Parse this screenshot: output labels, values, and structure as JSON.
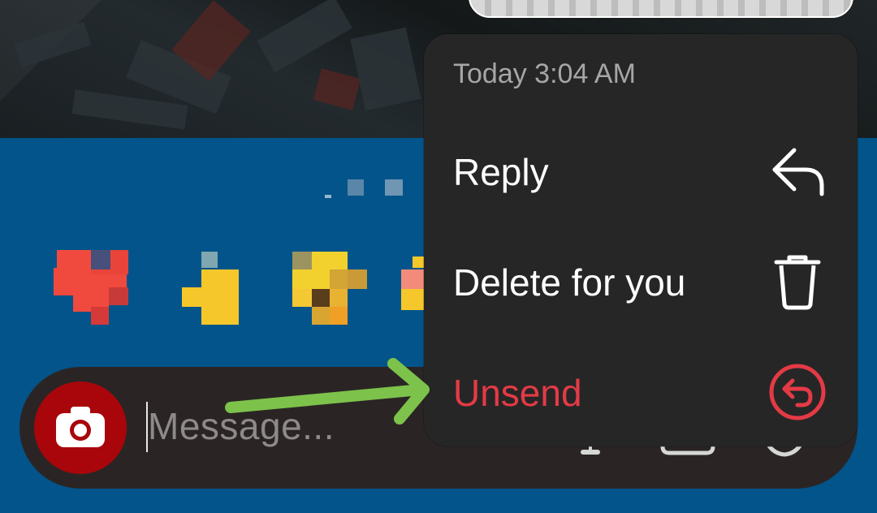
{
  "colors": {
    "background_blue": "#02548a",
    "menu_background": "#262626",
    "danger_red": "#e43a46",
    "camera_red": "#a8060a",
    "annotation_green": "#7dc24b"
  },
  "context_menu": {
    "timestamp": "Today 3:04 AM",
    "items": [
      {
        "label": "Reply",
        "icon": "reply-arrow-icon"
      },
      {
        "label": "Delete for you",
        "icon": "trash-icon"
      },
      {
        "label": "Unsend",
        "icon": "unsend-circle-icon",
        "style": "danger"
      }
    ]
  },
  "composer": {
    "placeholder": "Message...",
    "camera_icon": "camera-icon"
  }
}
